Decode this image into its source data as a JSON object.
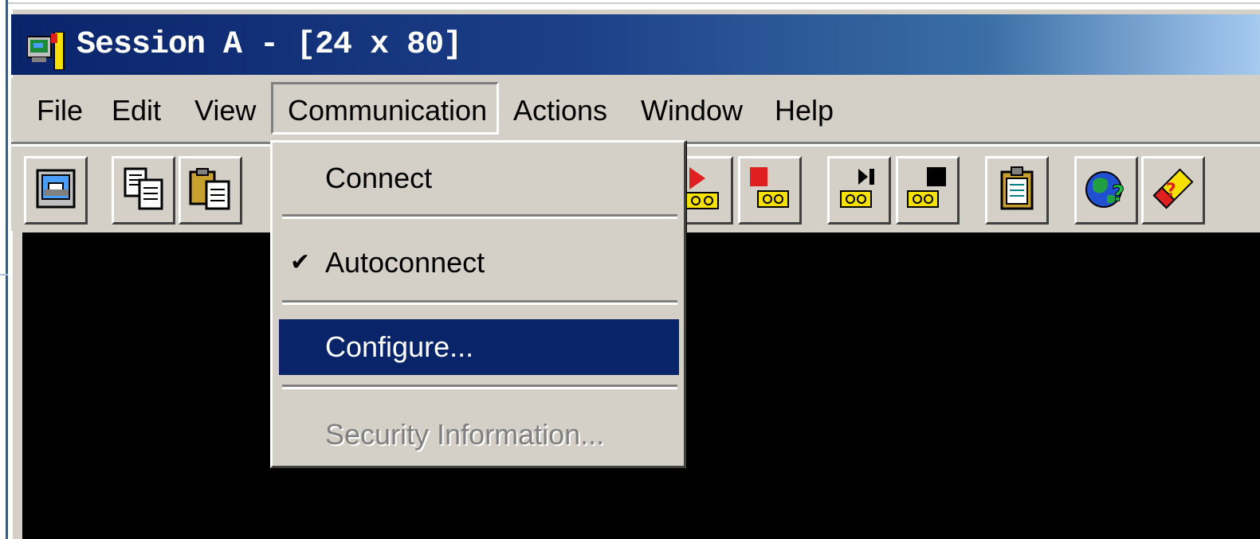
{
  "window": {
    "title": "Session A - [24 x 80]"
  },
  "menubar": {
    "items": [
      {
        "label": "File"
      },
      {
        "label": "Edit"
      },
      {
        "label": "View"
      },
      {
        "label": "Communication",
        "open": true
      },
      {
        "label": "Actions"
      },
      {
        "label": "Window"
      },
      {
        "label": "Help"
      }
    ]
  },
  "toolbar": {
    "icons": [
      "print-screen-icon",
      "copy-icon",
      "paste-icon",
      "play-macro-icon",
      "stop-macro-icon",
      "record-macro-icon",
      "pause-macro-icon",
      "clipboard-icon",
      "globe-help-icon",
      "eraser-icon"
    ]
  },
  "communication_menu": {
    "items": [
      {
        "label": "Connect",
        "checked": false,
        "highlighted": false,
        "disabled": false
      },
      {
        "label": "Autoconnect",
        "checked": true,
        "check_glyph": "✔",
        "highlighted": false,
        "disabled": false
      },
      {
        "label": "Configure...",
        "checked": false,
        "highlighted": true,
        "disabled": false
      },
      {
        "label": "Security Information...",
        "checked": false,
        "highlighted": false,
        "disabled": true
      }
    ]
  },
  "colors": {
    "titlebar_start": "#0a246a",
    "titlebar_end": "#a6caf0",
    "highlight": "#0a246a",
    "face": "#d4d0c8",
    "terminal": "#000000"
  }
}
